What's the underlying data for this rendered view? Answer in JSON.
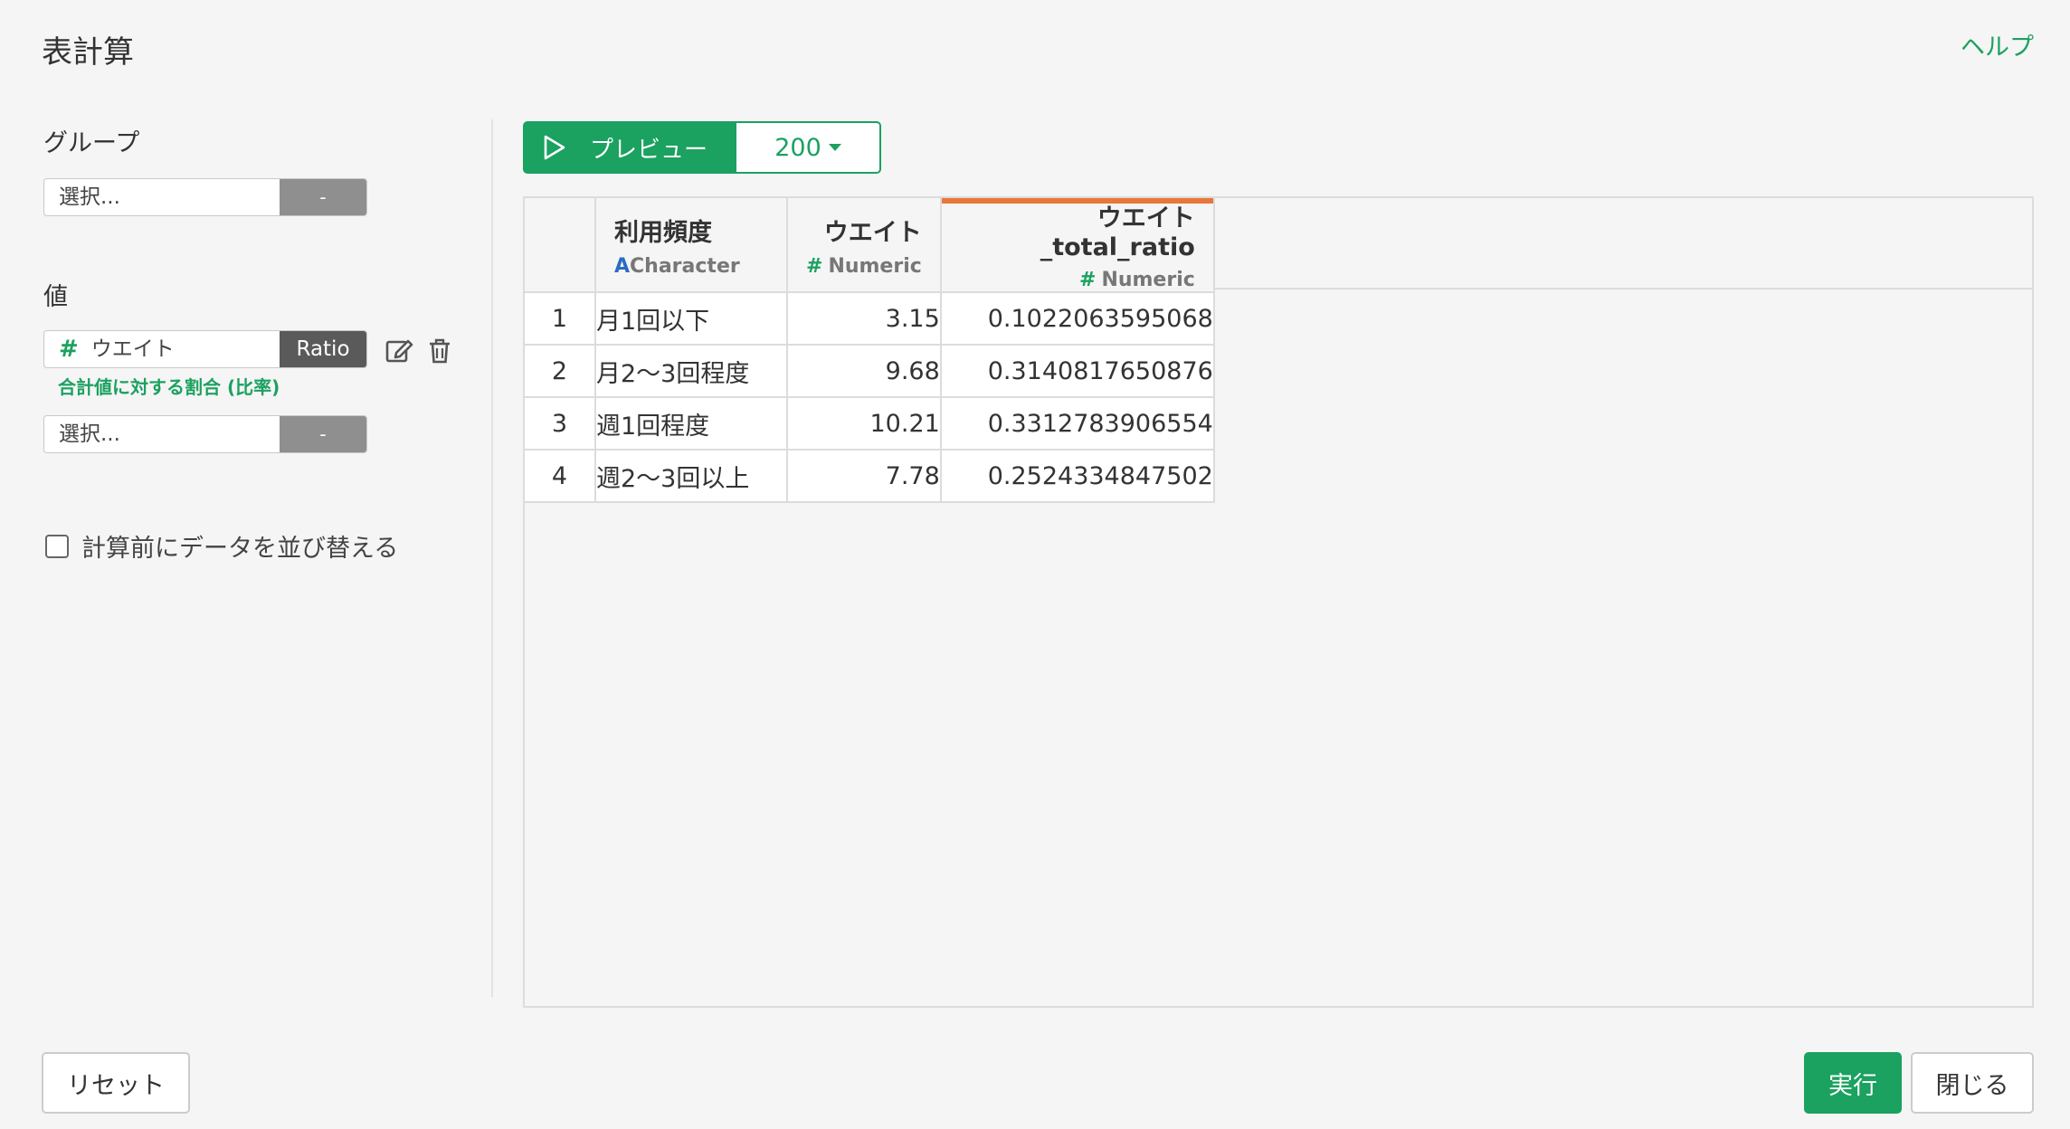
{
  "header": {
    "title": "表計算",
    "help_label": "ヘルプ"
  },
  "group": {
    "label": "グループ",
    "select": {
      "placeholder": "選択...",
      "button_label": "-"
    }
  },
  "values": {
    "label": "値",
    "items": [
      {
        "column": "ウエイト",
        "type_icon": "#",
        "function_label": "Ratio",
        "note": "合計値に対する割合 (比率)"
      }
    ],
    "new_select": {
      "placeholder": "選択...",
      "button_label": "-"
    }
  },
  "sort_option": {
    "label": "計算前にデータを並び替える",
    "checked": false
  },
  "preview": {
    "button_label": "プレビュー",
    "rows_value": "200"
  },
  "table": {
    "columns": [
      {
        "name": "利用頻度",
        "type": "Character",
        "type_icon": "A"
      },
      {
        "name": "ウエイト",
        "type": "Numeric",
        "type_icon": "#"
      },
      {
        "name": "ウエイト_total_ratio",
        "type": "Numeric",
        "type_icon": "#"
      }
    ],
    "rows": [
      {
        "index": "1",
        "cells": [
          "月1回以下",
          "3.15",
          "0.1022063595068"
        ]
      },
      {
        "index": "2",
        "cells": [
          "月2〜3回程度",
          "9.68",
          "0.3140817650876"
        ]
      },
      {
        "index": "3",
        "cells": [
          "週1回程度",
          "10.21",
          "0.3312783906554"
        ]
      },
      {
        "index": "4",
        "cells": [
          "週2〜3回以上",
          "7.78",
          "0.2524334847502"
        ]
      }
    ]
  },
  "footer": {
    "reset_label": "リセット",
    "run_label": "実行",
    "close_label": "閉じる"
  },
  "colors": {
    "accent": "#1ba160",
    "new_column_marker": "#e8773a",
    "character_icon": "#2b6cc4"
  }
}
